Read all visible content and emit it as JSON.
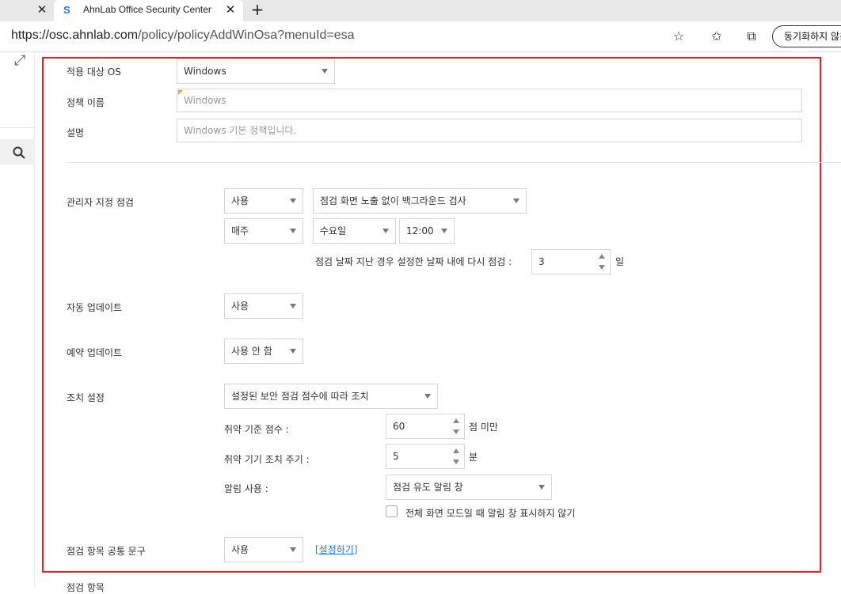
{
  "browser": {
    "tab_title": "AhnLab Office Security Center",
    "favicon": "S",
    "url_host": "https://osc.ahnlab.com",
    "url_path": "/policy/policyAddWinOsa?menuId=esa",
    "sync_label": "동기화하지 않음"
  },
  "form": {
    "os": {
      "label": "적용 대상 OS",
      "value": "Windows"
    },
    "policy_name": {
      "label": "정책 이름",
      "value": "Windows"
    },
    "description": {
      "label": "설명",
      "value": "Windows 기본 정책입니다."
    },
    "admin_scan": {
      "label": "관리자 지정 점검",
      "enable": "사용",
      "mode": "점검 화면 노출 없이 백그라운드 검사",
      "period": "매주",
      "day": "수요일",
      "time": "12:00",
      "rescan_label": "점검 날짜 지난 경우 설정한 날짜 내에 다시 점검 :",
      "rescan_value": "3",
      "rescan_unit": "일"
    },
    "auto_update": {
      "label": "자동 업데이트",
      "value": "사용"
    },
    "scheduled_update": {
      "label": "예약 업데이트",
      "value": "사용 안 함"
    },
    "action": {
      "label": "조치 설정",
      "value": "설정된 보안 점검 점수에 따라 조치",
      "threshold_label": "취약 기준 점수 :",
      "threshold_value": "60",
      "threshold_unit": "점 미만",
      "cycle_label": "취약 기기 조치 주기 :",
      "cycle_value": "5",
      "cycle_unit": "분",
      "alert_label": "알림 사용 :",
      "alert_value": "점검 유도 알림 창",
      "fullscreen_label": "전체 화면 모드일 때 알림 창 표시하지 않기"
    },
    "common_phrase": {
      "label": "점검 항목 공통 문구",
      "value": "사용",
      "link": "[설정하기]"
    },
    "next_section_label": "점검 항목"
  }
}
